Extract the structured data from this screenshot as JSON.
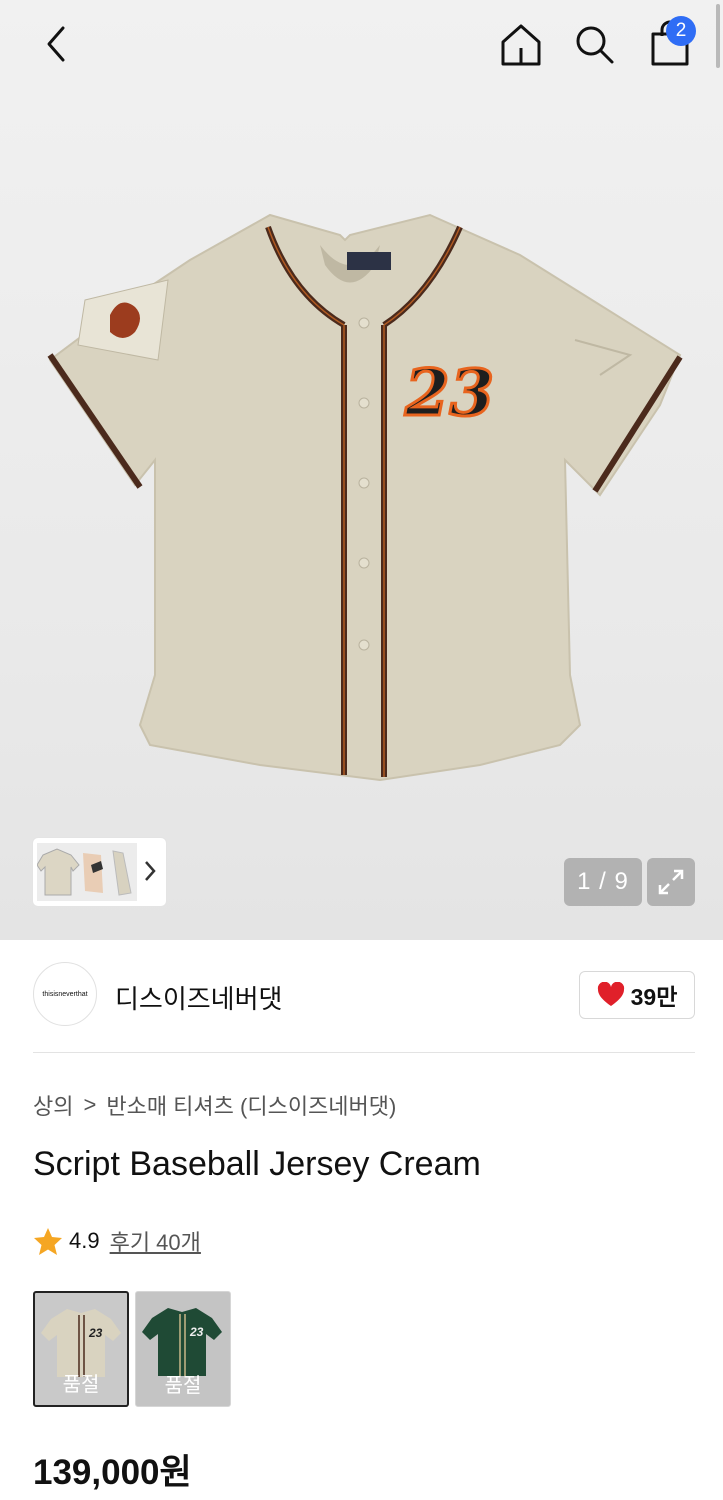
{
  "header": {
    "cart_count": "2"
  },
  "gallery": {
    "counter": "1 / 9"
  },
  "brand": {
    "logo_text": "thisisneverthat",
    "name": "디스이즈네버댓",
    "likes": "39만"
  },
  "breadcrumb": {
    "category": "상의",
    "separator": ">",
    "subcategory": "반소매 티셔츠 (디스이즈네버댓)"
  },
  "product": {
    "title": "Script Baseball Jersey Cream",
    "rating": "4.9",
    "reviews": "후기 40개",
    "price": "139,000원"
  },
  "color_options": [
    {
      "name": "cream",
      "status": "품절"
    },
    {
      "name": "green",
      "status": "품절"
    }
  ],
  "colors": {
    "badge": "#2f6df5",
    "like_heart": "#e0202a",
    "star": "#f5a623",
    "jersey_cream": "#d9d3c0",
    "jersey_green": "#1f4a35",
    "piping": "#4b2a1c"
  },
  "icons": [
    "chevron-left-icon",
    "home-icon",
    "search-icon",
    "shopping-bag-icon",
    "chevron-right-icon",
    "expand-icon",
    "heart-icon",
    "star-icon"
  ]
}
